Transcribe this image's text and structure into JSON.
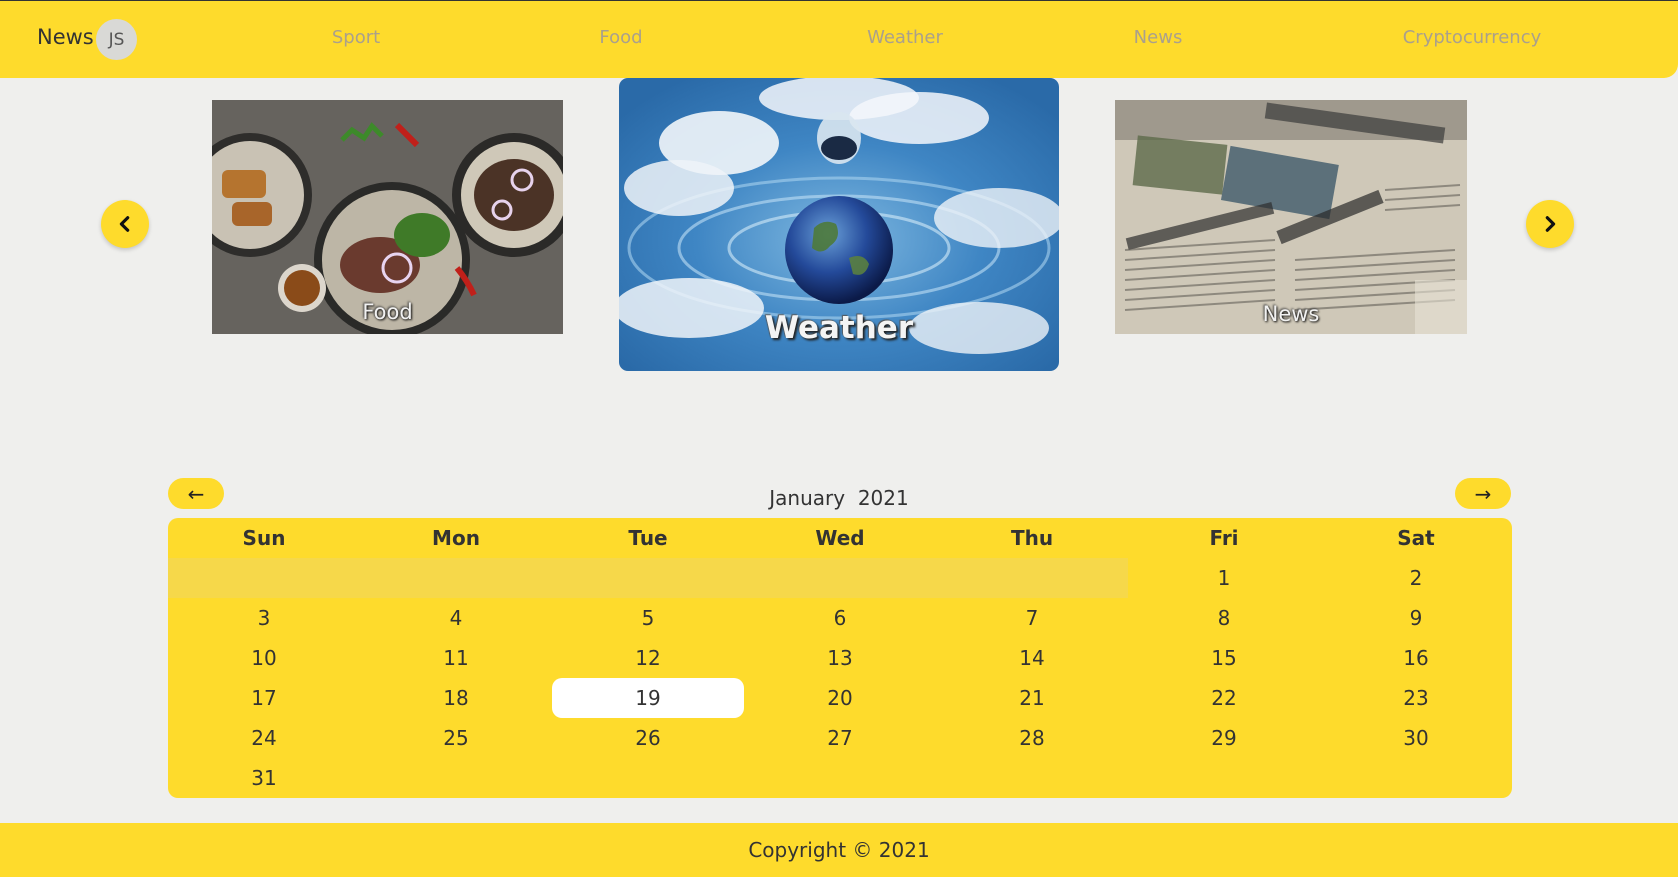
{
  "header": {
    "brand": "News",
    "avatar_initials": "JS",
    "nav": [
      "Sport",
      "Food",
      "Weather",
      "News",
      "Cryptocurrency"
    ]
  },
  "carousel": {
    "prev_icon": "chevron-left-icon",
    "next_icon": "chevron-right-icon",
    "cards": [
      {
        "label": "Food"
      },
      {
        "label": "Weather"
      },
      {
        "label": "News"
      }
    ]
  },
  "calendar": {
    "prev_label": "←",
    "next_label": "→",
    "title": "January  2021",
    "weekdays": [
      "Sun",
      "Mon",
      "Tue",
      "Wed",
      "Thu",
      "Fri",
      "Sat"
    ],
    "leading_blank_days": 5,
    "days_in_month": 31,
    "highlighted_day": 19
  },
  "footer": {
    "copyright": "Copyright © 2021"
  },
  "colors": {
    "accent": "#fedb2c",
    "background": "#efefed"
  }
}
